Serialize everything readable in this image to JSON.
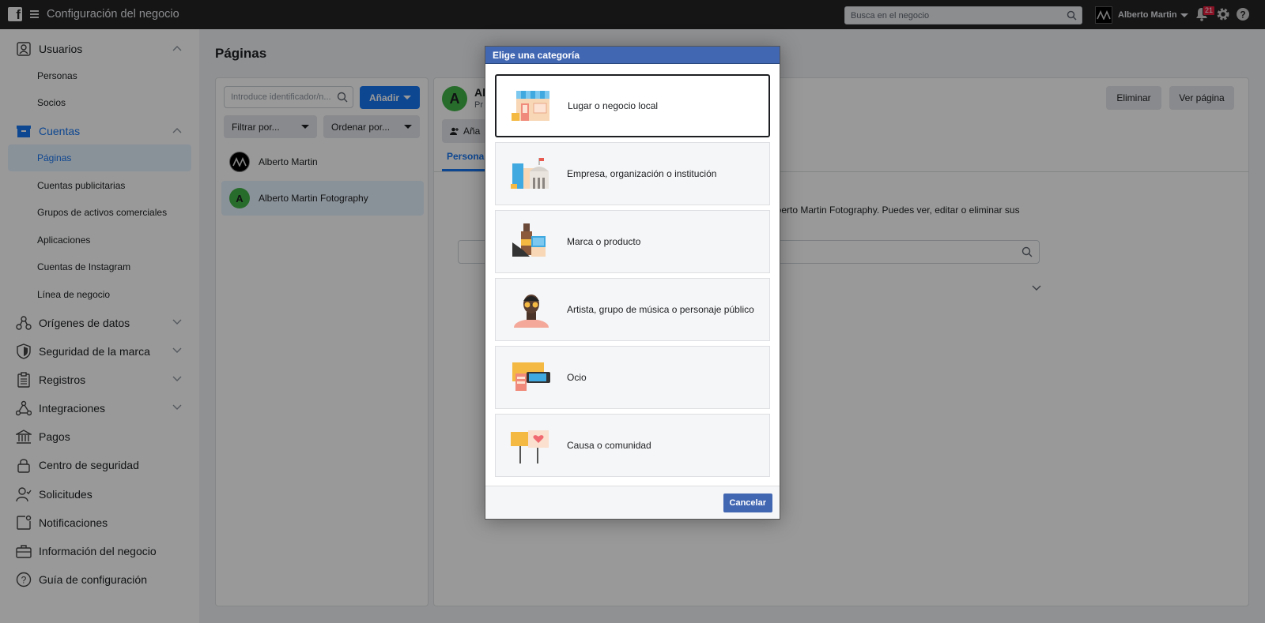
{
  "topbar": {
    "title": "Configuración del negocio",
    "search_placeholder": "Busca en el negocio",
    "user_name": "Alberto Martin",
    "notifications_count": "21"
  },
  "sidebar": {
    "items": [
      {
        "label": "Usuarios",
        "icon": "user-card-icon",
        "expanded": true
      },
      {
        "label": "Personas"
      },
      {
        "label": "Socios"
      },
      {
        "label": "Cuentas",
        "icon": "archive-box-icon",
        "expanded": true
      },
      {
        "label": "Páginas",
        "active": true
      },
      {
        "label": "Cuentas publicitarias"
      },
      {
        "label": "Grupos de activos comerciales"
      },
      {
        "label": "Aplicaciones"
      },
      {
        "label": "Cuentas de Instagram"
      },
      {
        "label": "Línea de negocio"
      },
      {
        "label": "Orígenes de datos",
        "icon": "data-sources-icon"
      },
      {
        "label": "Seguridad de la marca",
        "icon": "shield-icon"
      },
      {
        "label": "Registros",
        "icon": "clipboard-icon"
      },
      {
        "label": "Integraciones",
        "icon": "integrations-icon"
      },
      {
        "label": "Pagos",
        "icon": "bank-icon"
      },
      {
        "label": "Centro de seguridad",
        "icon": "lock-icon"
      },
      {
        "label": "Solicitudes",
        "icon": "user-check-icon"
      },
      {
        "label": "Notificaciones",
        "icon": "notification-icon"
      },
      {
        "label": "Información del negocio",
        "icon": "briefcase-icon"
      },
      {
        "label": "Guía de configuración",
        "icon": "question-icon"
      }
    ]
  },
  "main": {
    "title": "Páginas",
    "id_search_placeholder": "Introduce identificador/n...",
    "add_button": "Añadir",
    "filter_label": "Filtrar por...",
    "sort_label": "Ordenar por...",
    "pages": [
      {
        "name": "Alberto Martin"
      },
      {
        "name": "Alberto Martin Fotography",
        "initial": "A",
        "selected": true
      }
    ]
  },
  "detail": {
    "avatar_initial": "A",
    "name_fragment": "Al",
    "sub_fragment": "Pr",
    "delete_button": "Eliminar",
    "view_button": "Ver página",
    "add_people_fragment": "Aña",
    "tab_fragment": "Persona",
    "desc_fragment": "lberto Martin Fotography. Puedes ver, editar o eliminar sus"
  },
  "modal": {
    "title": "Elige una categoría",
    "categories": [
      {
        "label": "Lugar o negocio local",
        "icon": "storefront-icon",
        "selected": true
      },
      {
        "label": "Empresa, organización o institución",
        "icon": "buildings-icon"
      },
      {
        "label": "Marca o producto",
        "icon": "products-icon"
      },
      {
        "label": "Artista, grupo de música o personaje público",
        "icon": "artist-icon"
      },
      {
        "label": "Ocio",
        "icon": "entertainment-icon"
      },
      {
        "label": "Causa o comunidad",
        "icon": "protest-signs-icon"
      }
    ],
    "cancel_button": "Cancelar"
  },
  "colors": {
    "accent": "#1877f2",
    "modal_header": "#4267b2",
    "topbar": "#232323"
  }
}
